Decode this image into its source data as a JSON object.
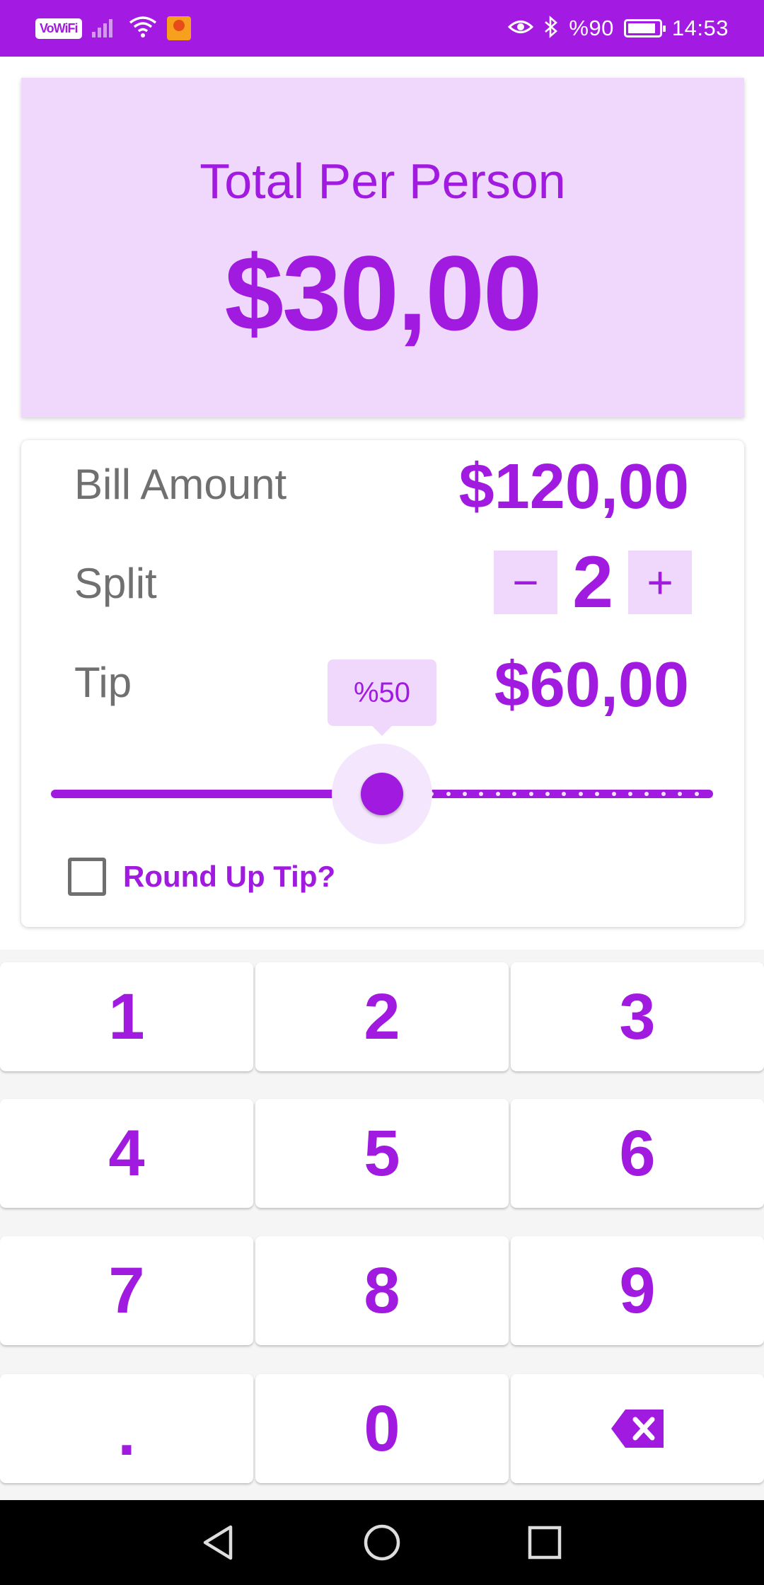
{
  "status_bar": {
    "vowifi": "VoWiFi",
    "battery_text": "%90",
    "time": "14:53"
  },
  "total": {
    "label": "Total Per Person",
    "value": "$30,00"
  },
  "bill": {
    "label": "Bill Amount",
    "value": "$120,00"
  },
  "split": {
    "label": "Split",
    "decrement": "−",
    "count": "2",
    "increment": "+"
  },
  "tip": {
    "label": "Tip",
    "value": "$60,00",
    "percent_label": "%50",
    "slider_fraction": 0.5
  },
  "round_up": {
    "label": "Round Up Tip?",
    "checked": false
  },
  "keypad": {
    "keys": [
      "1",
      "2",
      "3",
      "4",
      "5",
      "6",
      "7",
      "8",
      "9",
      ".",
      "0",
      "backspace"
    ]
  },
  "colors": {
    "accent": "#a11ae0",
    "accent_light": "#efd8fc",
    "label_gray": "#707070"
  }
}
